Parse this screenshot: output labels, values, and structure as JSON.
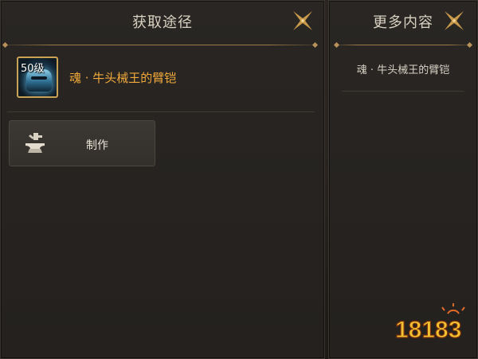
{
  "left_panel": {
    "title": "获取途径",
    "item": {
      "level_badge": "50级",
      "name": "魂 · 牛头械王的臂铠"
    },
    "craft_button_label": "制作"
  },
  "right_panel": {
    "title": "更多内容",
    "items": [
      {
        "label": "魂 · 牛头械王的臂铠"
      }
    ]
  },
  "watermark": {
    "text": "18183"
  },
  "icons": {
    "close": "close-icon",
    "anvil": "anvil-icon",
    "item": "armor-item-icon"
  },
  "colors": {
    "item_name": "#f0a93a",
    "gold_accent": "#c9a254",
    "panel_bg": "#272420",
    "title_text": "#d9d2c2"
  }
}
